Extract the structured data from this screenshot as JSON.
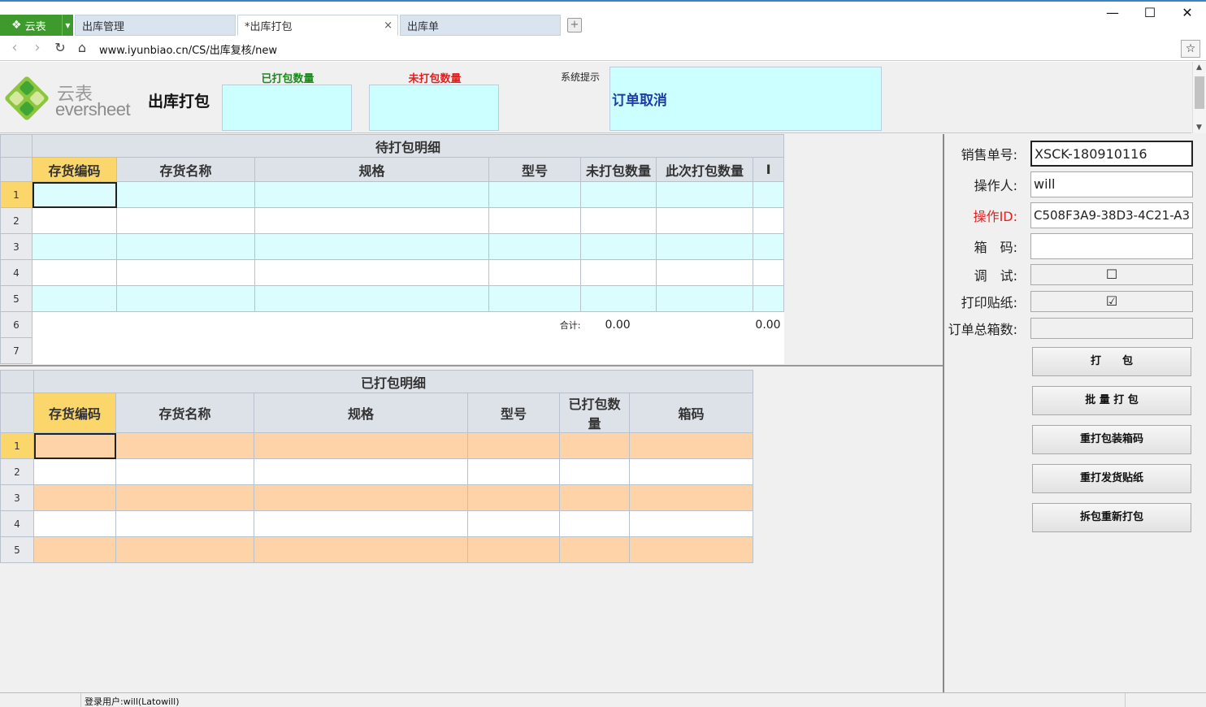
{
  "browser": {
    "app_name": "云表",
    "tabs": [
      {
        "label": "出库管理"
      },
      {
        "label": "*出库打包",
        "close": "×"
      },
      {
        "label": "出库单"
      }
    ],
    "new_tab": "+",
    "window_controls": {
      "minimize": "—",
      "maximize": "☐",
      "close": "✕"
    },
    "url": "www.iyunbiao.cn/CS/出库复核/new"
  },
  "header": {
    "logo_cn": "云表",
    "logo_en": "eversheet",
    "page_title": "出库打包",
    "packed_label": "已打包数量",
    "packed_value": "",
    "unpacked_label": "未打包数量",
    "unpacked_value": "",
    "system_hint_label": "系统提示",
    "system_hint_text": "订单取消",
    "colors": {
      "packed_label": "#1a8a1a",
      "unpacked_label": "#e02020",
      "hint_text": "#1f3ca6"
    }
  },
  "pending_table": {
    "title": "待打包明细",
    "columns": [
      "存货编码",
      "存货名称",
      "规格",
      "型号",
      "未打包数量",
      "此次打包数量",
      "I"
    ],
    "row_numbers": [
      "1",
      "2",
      "3",
      "4",
      "5",
      "6",
      "7"
    ],
    "total_label": "合计:",
    "total_unpacked": "0.00",
    "total_this": "0.00"
  },
  "packed_table": {
    "title": "已打包明细",
    "columns": [
      "存货编码",
      "存货名称",
      "规格",
      "型号",
      "已打包数量",
      "箱码"
    ],
    "row_numbers": [
      "1",
      "2",
      "3",
      "4",
      "5"
    ]
  },
  "form": {
    "order_no_label": "销售单号:",
    "order_no_value": "XSCK-180910116",
    "operator_label": "操作人:",
    "operator_value": "will",
    "op_id_label": "操作ID:",
    "op_id_value": "C508F3A9-38D3-4C21-A3",
    "box_code_label": "箱　码:",
    "box_code_value": "",
    "debug_label": "调　试:",
    "debug_check": "☐",
    "print_sticker_label": "打印贴纸:",
    "print_sticker_check": "☑",
    "total_boxes_label": "订单总箱数:",
    "total_boxes_value": "",
    "op_id_color": "#e02020"
  },
  "buttons": {
    "pack": "打　　包",
    "batch_pack": "批 量 打 包",
    "reprint_box": "重打包装箱码",
    "reprint_ship": "重打发货贴纸",
    "unpack_repack": "拆包重新打包"
  },
  "status": {
    "login_user": "登录用户:will(Latowill)"
  }
}
